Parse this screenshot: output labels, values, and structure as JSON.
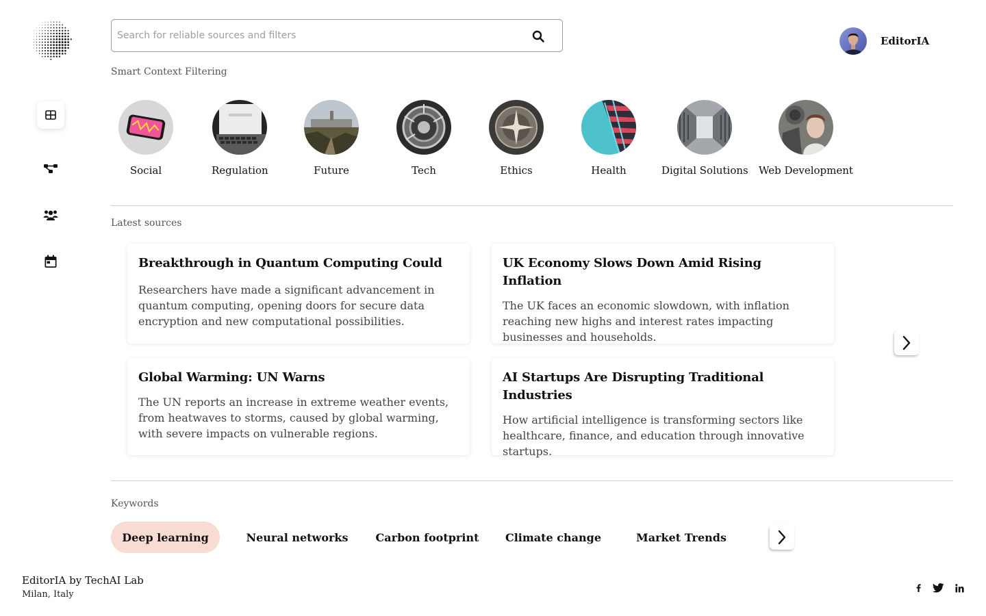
{
  "app": {
    "brand": "EditorIA"
  },
  "search": {
    "placeholder": "Search for reliable sources and filters",
    "value": ""
  },
  "user": {
    "name": "EditorIA"
  },
  "sidebar": {
    "items": [
      {
        "icon": "grid-icon",
        "active": true
      },
      {
        "icon": "network-icon",
        "active": false
      },
      {
        "icon": "users-icon",
        "active": false
      },
      {
        "icon": "calendar-icon",
        "active": false
      }
    ]
  },
  "categories": {
    "title": "Smart Context Filtering",
    "items": [
      {
        "label": "Social"
      },
      {
        "label": "Regulation"
      },
      {
        "label": "Future"
      },
      {
        "label": "Tech"
      },
      {
        "label": "Ethics"
      },
      {
        "label": "Health"
      },
      {
        "label": "Digital Solutions"
      },
      {
        "label": "Web Development"
      }
    ]
  },
  "sources": {
    "title": "Latest sources",
    "items": [
      {
        "title": "Breakthrough in Quantum Computing Could",
        "text": "Researchers have made a significant advancement in quantum computing, opening doors for secure data encryption and new computational possibilities."
      },
      {
        "title": "UK Economy Slows Down Amid Rising Inflation",
        "text": "The UK faces an economic slowdown, with inflation reaching new highs and interest rates impacting businesses and households."
      },
      {
        "title": "Global Warming: UN Warns",
        "text": "The UN reports an increase in extreme weather events, from heatwaves to storms, caused by global warming, with severe impacts on vulnerable regions."
      },
      {
        "title": "AI Startups Are Disrupting Traditional Industries",
        "text": "How artificial intelligence is transforming sectors like healthcare, finance, and education through innovative startups."
      }
    ]
  },
  "keywords": {
    "title": "Keywords",
    "items": [
      {
        "label": "Deep learning",
        "active": true
      },
      {
        "label": "Neural networks",
        "active": false
      },
      {
        "label": "Carbon footprint",
        "active": false
      },
      {
        "label": "Climate change",
        "active": false
      },
      {
        "label": "Market Trends",
        "active": false
      }
    ]
  },
  "footer": {
    "brand": "EditorIA by TechAI Lab",
    "location": "Milan, Italy",
    "social": [
      "facebook-icon",
      "twitter-icon",
      "linkedin-icon"
    ]
  },
  "colors": {
    "accent_pill": "#f8dcd3",
    "divider": "#cfcfcf",
    "text": "#111111"
  }
}
